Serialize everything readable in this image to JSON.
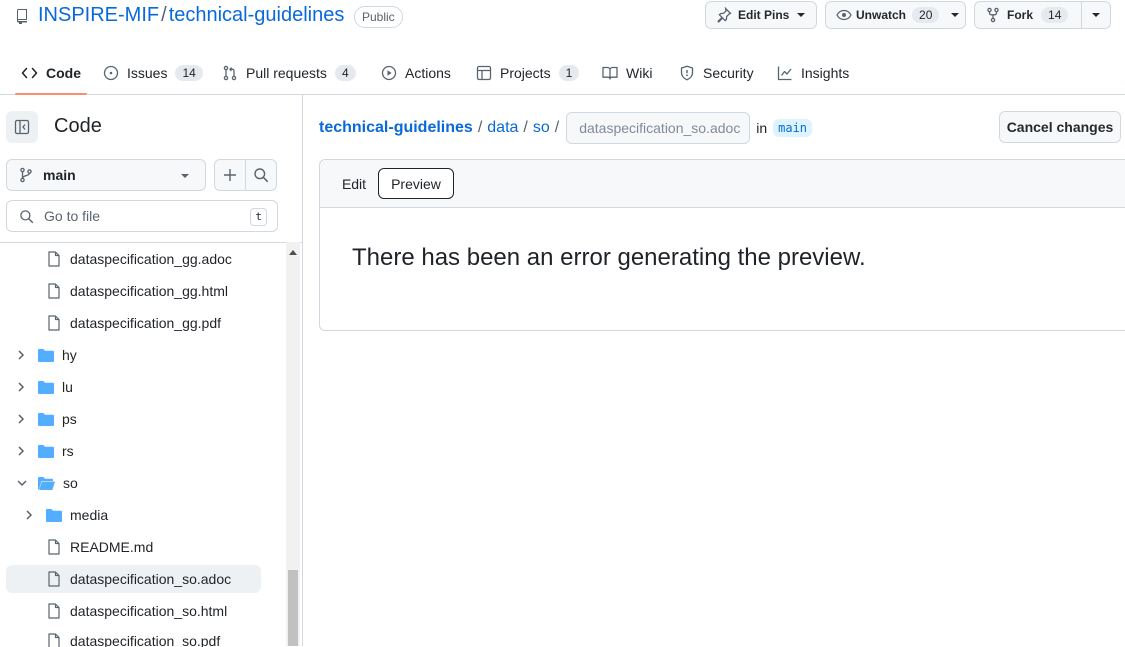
{
  "repo": {
    "owner": "INSPIRE-MIF",
    "name": "technical-guidelines",
    "visibility": "Public"
  },
  "actions": {
    "edit_pins": "Edit Pins",
    "unwatch": "Unwatch",
    "watch_count": "20",
    "fork": "Fork",
    "fork_count": "14"
  },
  "nav": {
    "code": "Code",
    "issues": "Issues",
    "issues_count": "14",
    "pull_requests": "Pull requests",
    "pull_requests_count": "4",
    "actions": "Actions",
    "projects": "Projects",
    "projects_count": "1",
    "wiki": "Wiki",
    "security": "Security",
    "insights": "Insights"
  },
  "sidebar": {
    "title": "Code",
    "branch": "main",
    "search_placeholder": "Go to file",
    "search_shortcut": "t",
    "tree": [
      {
        "label": "dataspecification_gg.adoc",
        "type": "file"
      },
      {
        "label": "dataspecification_gg.html",
        "type": "file"
      },
      {
        "label": "dataspecification_gg.pdf",
        "type": "file"
      },
      {
        "label": "hy",
        "type": "folder"
      },
      {
        "label": "lu",
        "type": "folder"
      },
      {
        "label": "ps",
        "type": "folder"
      },
      {
        "label": "rs",
        "type": "folder"
      },
      {
        "label": "so",
        "type": "folder-open"
      },
      {
        "label": "media",
        "type": "folder"
      },
      {
        "label": "README.md",
        "type": "file"
      },
      {
        "label": "dataspecification_so.adoc",
        "type": "file",
        "selected": true
      },
      {
        "label": "dataspecification_so.html",
        "type": "file"
      },
      {
        "label": "dataspecification_so.pdf",
        "type": "file"
      }
    ]
  },
  "editor": {
    "breadcrumb": [
      "technical-guidelines",
      "data",
      "so"
    ],
    "filename": "dataspecification_so.adoc",
    "in_label": "in",
    "branch": "main",
    "cancel_label": "Cancel changes",
    "tab_edit": "Edit",
    "tab_preview": "Preview",
    "preview_message": "There has been an error generating the preview."
  },
  "colors": {
    "link": "#0969da",
    "accent_underline": "#fd8c73",
    "folder": "#54aeff",
    "border": "#d1d9e0"
  }
}
